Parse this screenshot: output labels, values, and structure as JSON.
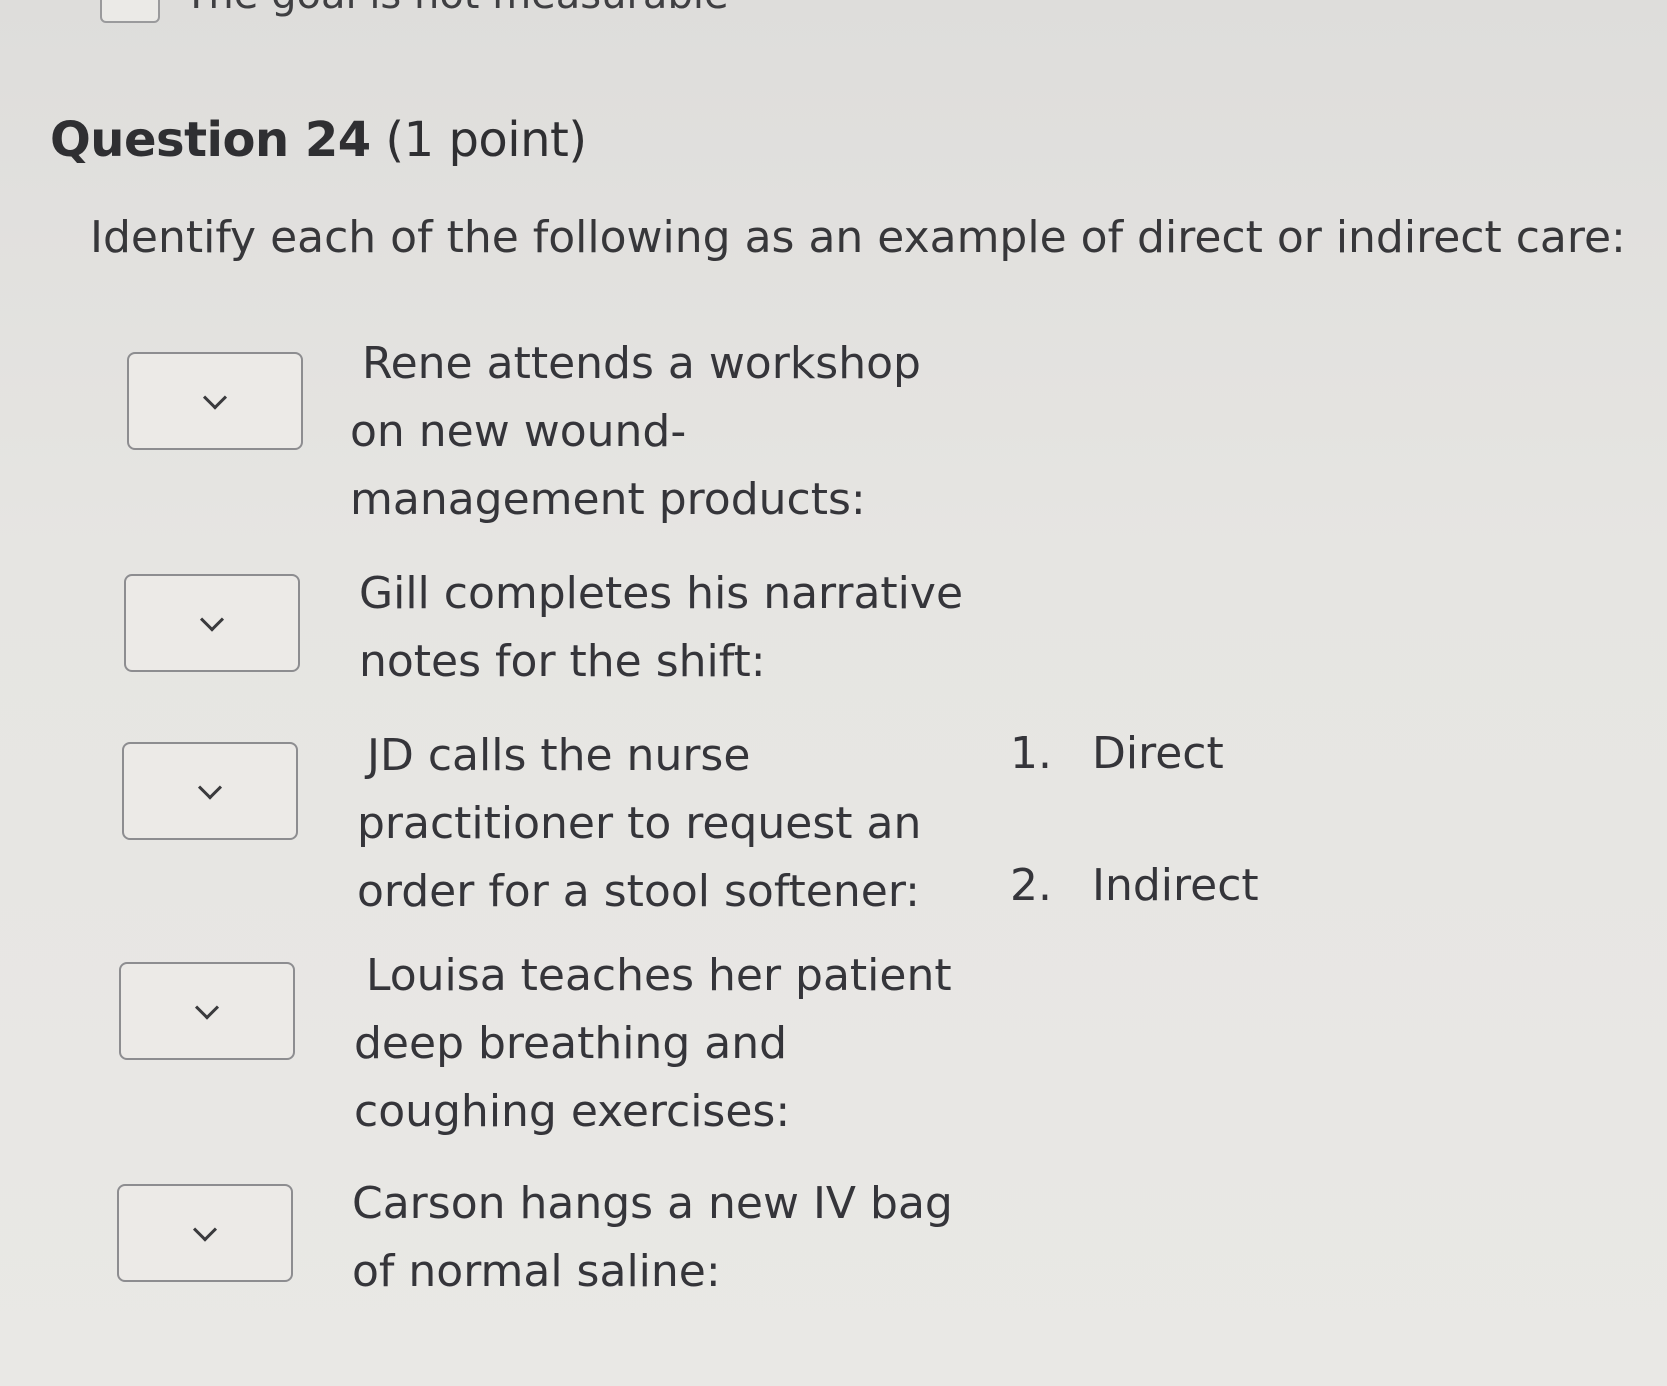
{
  "top_partial_option": {
    "label": "The goal is not measurable"
  },
  "question": {
    "number": "Question 24",
    "points": "(1 point)",
    "prompt": "Identify each of the following as an example of direct or indirect care:"
  },
  "items": [
    {
      "lines": [
        "Rene attends a workshop",
        "on new wound-",
        "management products:"
      ],
      "selected": ""
    },
    {
      "lines": [
        "Gill completes his narrative",
        "notes for the shift:"
      ],
      "selected": ""
    },
    {
      "lines": [
        "JD calls the nurse",
        "practitioner to request an",
        "order for a stool softener:"
      ],
      "selected": ""
    },
    {
      "lines": [
        "Louisa teaches her patient",
        "deep breathing and",
        "coughing exercises:"
      ],
      "selected": ""
    },
    {
      "lines": [
        "Carson hangs a new IV bag",
        "of normal saline:"
      ],
      "selected": ""
    }
  ],
  "options": [
    {
      "number": "1.",
      "label": "Direct"
    },
    {
      "number": "2.",
      "label": "Indirect"
    }
  ],
  "icons": {
    "dropdown": "chevron-down-icon"
  }
}
